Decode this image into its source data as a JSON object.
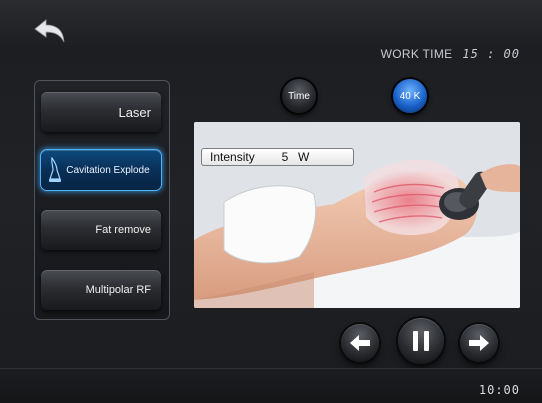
{
  "header": {
    "worktime_label": "WORK TIME",
    "worktime_value": "15 : 00"
  },
  "controls": {
    "time_label": "Time",
    "freq_label": "40 K"
  },
  "modes": [
    {
      "label": "Laser",
      "active": false
    },
    {
      "label": "Cavitation Explode",
      "active": true
    },
    {
      "label": "Fat remove",
      "active": false
    },
    {
      "label": "Multipolar RF",
      "active": false
    }
  ],
  "intensity": {
    "label": "Intensity",
    "value": "5",
    "unit": "W"
  },
  "footer": {
    "clock": "10:00"
  },
  "icons": {
    "back": "back-arrow-icon",
    "prev": "left-arrow-icon",
    "pause": "pause-icon",
    "next": "right-arrow-icon",
    "mode": "cavitation-probe-icon"
  },
  "colors": {
    "accent": "#1a62c9",
    "active_glow": "#4fb2ff",
    "background": "#1f2124"
  }
}
